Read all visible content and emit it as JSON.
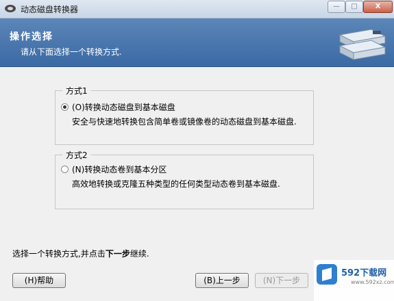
{
  "window": {
    "title": "动态磁盘转换器",
    "controls": {
      "minimize": "—",
      "maximize": "□",
      "close": "X"
    }
  },
  "header": {
    "title": "操作选择",
    "subtitle": "请从下面选择一个转换方式."
  },
  "options": [
    {
      "group_label": "方式1",
      "label": "(O)转换动态磁盘到基本磁盘",
      "description": "安全与快速地转换包含简单卷或镜像卷的动态磁盘到基本磁盘.",
      "selected": true
    },
    {
      "group_label": "方式2",
      "label": "(N)转换动态卷到基本分区",
      "description": "高效地转换或克隆五种类型的任何类型动态卷到基本磁盘.",
      "selected": false
    }
  ],
  "hint": {
    "prefix": "选择一个转换方式,并点击",
    "emphasis": "下一步",
    "suffix": "继续."
  },
  "buttons": {
    "help": "(H)帮助",
    "back": "(B)上一步",
    "next": "(N)下一步"
  },
  "watermark": {
    "text": "592下载网",
    "url": "www.592xz.com"
  },
  "colors": {
    "header_bg": "#3a69a4",
    "window_bg": "#f0f0f0",
    "watermark_brand": "#1f5fa8"
  }
}
